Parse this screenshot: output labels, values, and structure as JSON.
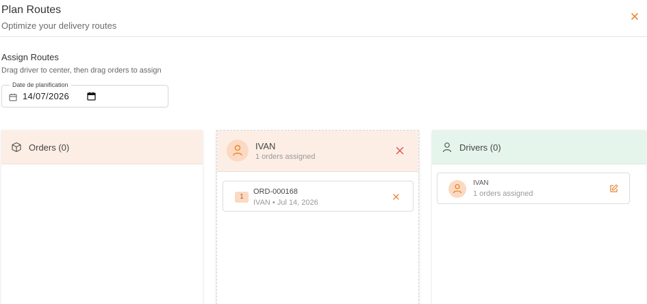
{
  "header": {
    "title": "Plan Routes",
    "subtitle": "Optimize your delivery routes"
  },
  "assign": {
    "title": "Assign Routes",
    "subtitle": "Drag driver to center, then drag orders to assign"
  },
  "date_field": {
    "label": "Date de planification",
    "value": "14/07/2026"
  },
  "orders_column": {
    "label": "Orders (0)"
  },
  "center_column": {
    "driver_name": "IVAN",
    "assigned_text": "1 orders assigned",
    "orders": [
      {
        "badge": "1",
        "id": "ORD-000168",
        "meta": "IVAN • Jul 14, 2026"
      }
    ]
  },
  "drivers_column": {
    "label": "Drivers (0)",
    "drivers": [
      {
        "name": "IVAN",
        "assigned_text": "1 orders assigned"
      }
    ]
  },
  "colors": {
    "accent": "#e8872e",
    "danger": "#e2524a",
    "orders_header_bg": "#fdeee5",
    "drivers_header_bg": "#e6f5ec",
    "avatar_bg": "#fcd9c2"
  },
  "icons": {
    "close": "close-icon",
    "calendar": "calendar-icon",
    "orders": "box-icon",
    "driver": "user-icon",
    "edit": "edit-icon"
  }
}
